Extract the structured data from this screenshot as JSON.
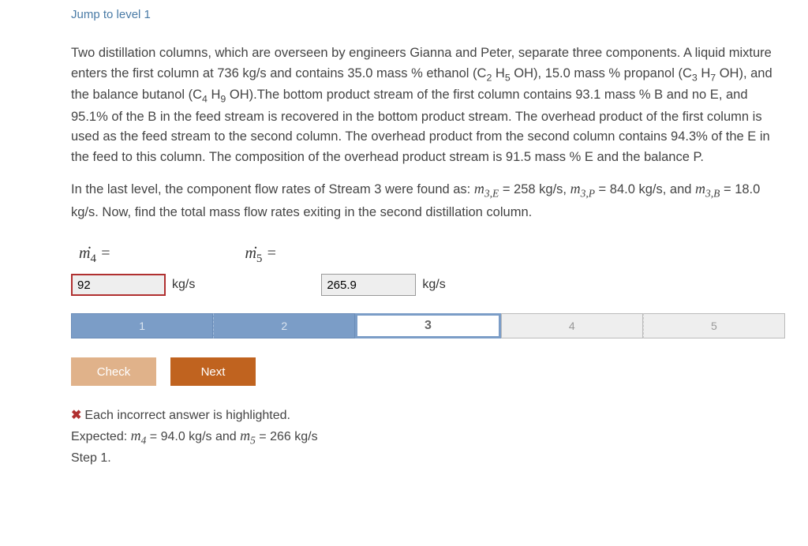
{
  "jump_link": "Jump to level 1",
  "problem_p1": "Two distillation columns, which are overseen by engineers Gianna and Peter, separate three components. A liquid mixture enters the first column at 736 kg/s and contains 35.0 mass % ethanol (C₂H₅OH), 15.0 mass % propanol (C₃H₇OH), and the balance butanol (C₄H₉OH). The bottom product stream of the first column contains 93.1 mass % B and no E, and 95.1% of the B in the feed stream is recovered in the bottom product stream. The overhead product of the first column is used as the feed stream to the second column. The overhead product from the second column contains 94.3% of the E in the feed to this column. The composition of the overhead product stream is 91.5 mass % E and the balance P.",
  "problem_p2_prefix": "In the last level, the component flow rates of Stream 3 were found as: ",
  "m3E_val": " = 258 kg/s, ",
  "m3P_val": " = 84.0 kg/s, and ",
  "m3B_val": " = 18.0 kg/s. Now, find the total mass flow rates exiting in the second distillation column.",
  "answers": {
    "m4": {
      "value": "92",
      "unit": "kg/s"
    },
    "m5": {
      "value": "265.9",
      "unit": "kg/s"
    }
  },
  "steps": [
    "1",
    "2",
    "3",
    "4",
    "5"
  ],
  "current_step_index": 2,
  "buttons": {
    "check": "Check",
    "next": "Next"
  },
  "feedback": {
    "line1": "Each incorrect answer is highlighted.",
    "line2_prefix": "Expected: ",
    "exp_m4": " = 94.0 kg/s and ",
    "exp_m5": " = 266 kg/s",
    "line3": "Step 1."
  }
}
